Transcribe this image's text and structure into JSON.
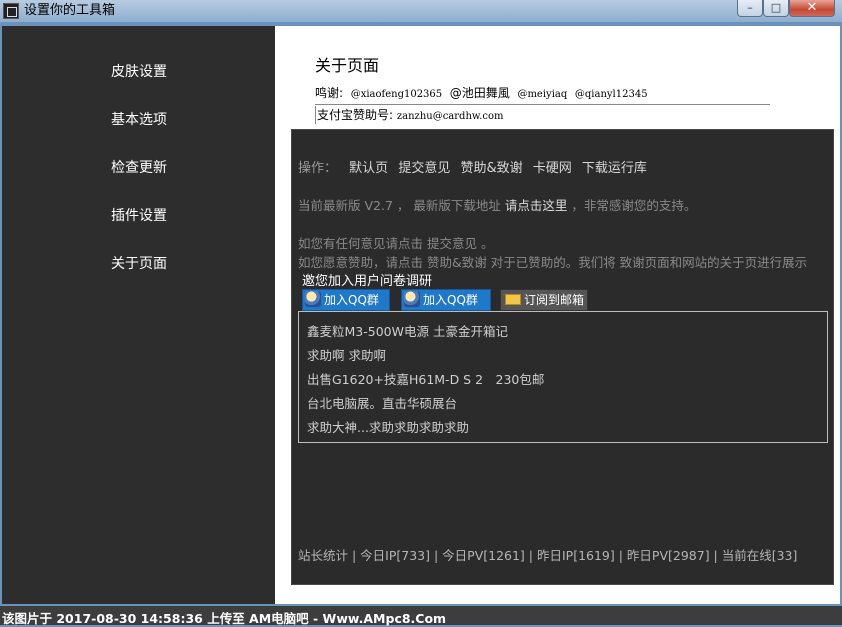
{
  "window": {
    "title": "设置你的工具箱",
    "minimize": "–",
    "maximize": "□",
    "close": "✕"
  },
  "sidebar": {
    "items": [
      {
        "label": "皮肤设置"
      },
      {
        "label": "基本选项"
      },
      {
        "label": "检查更新"
      },
      {
        "label": "插件设置"
      },
      {
        "label": "关于页面"
      }
    ]
  },
  "about": {
    "title": "关于页面",
    "thanks_label": "鸣谢:",
    "thanks_names": [
      "@xiaofeng102365",
      "@池田舞風",
      "@meiyiaq",
      "@qianyl12345"
    ],
    "alipay_label": "支付宝赞助号:",
    "alipay_value": "zanzhu@cardhw.com"
  },
  "panel": {
    "ops_label": "操作：",
    "ops_links": [
      "默认页",
      "提交意见",
      "赞助&致谢",
      "卡硬网",
      "下载运行库"
    ],
    "version_text": "当前最新版 V2.7 ， 最新版下载地址",
    "version_link": "请点击这里",
    "version_tail": "，非常感谢您的支持。",
    "feedback_text": "如您有任何意见请点击 提交意见 。",
    "sponsor_text": "如您愿意赞助，请点击 赞助&致谢 对于已赞助的。我们将 致谢页面和网站的关于页进行展示",
    "survey": "邀您加入用户问卷调研",
    "qq1": "加入QQ群",
    "qq2": "加入QQ群",
    "mail": "订阅到邮箱",
    "news": [
      "鑫麦粒M3-500W电源 土豪金开箱记",
      "求助啊 求助啊",
      "出售G1620+技嘉H61M-D S 2　230包邮",
      "台北电脑展。直击华硕展台",
      "求助大神...求助求助求助求助"
    ],
    "stats": "站长统计 | 今日IP[733] | 今日PV[1261] | 昨日IP[1619] | 昨日PV[2987] | 当前在线[33]"
  },
  "watermark": "该图片于 2017-08-30 14:58:36 上传至 AM电脑吧 - Www.AMpc8.Com"
}
